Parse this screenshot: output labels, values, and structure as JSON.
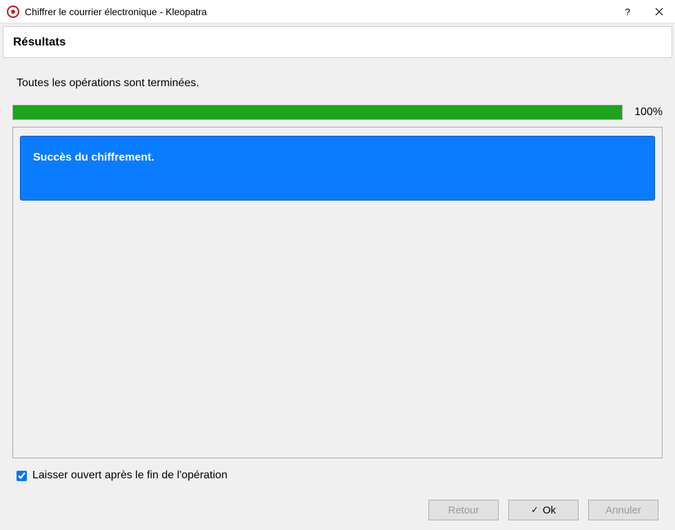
{
  "titlebar": {
    "title": "Chiffrer le courrier électronique - Kleopatra"
  },
  "header": {
    "title": "Résultats"
  },
  "status": {
    "message": "Toutes les opérations sont terminées.",
    "progress_percent": "100%"
  },
  "result": {
    "success_message": "Succès du chiffrement."
  },
  "checkbox": {
    "label": "Laisser ouvert après le fin de l'opération",
    "checked": true
  },
  "buttons": {
    "back": "Retour",
    "ok": "Ok",
    "cancel": "Annuler"
  }
}
